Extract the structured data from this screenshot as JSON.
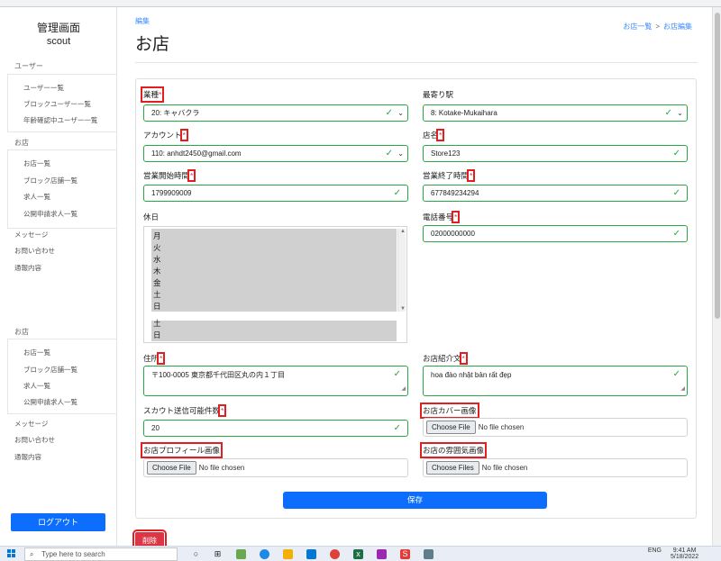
{
  "sidebar": {
    "title": "管理画面",
    "subtitle": "scout",
    "group_users": "ユーザー",
    "users_items": [
      "ユーザー一覧",
      "ブロックユーザー一覧",
      "年齢確認中ユーザー一覧"
    ],
    "group_shops": "お店",
    "shop_items": [
      "お店一覧",
      "ブロック店舗一覧",
      "求人一覧",
      "公開申請求人一覧"
    ],
    "links": [
      "メッセージ",
      "お問い合わせ",
      "通報内容"
    ],
    "group_shops_2": "お店",
    "shop_items_2": [
      "お店一覧",
      "ブロック店舗一覧",
      "求人一覧",
      "公開申請求人一覧"
    ],
    "links_2": [
      "メッセージ",
      "お問い合わせ",
      "通報内容"
    ],
    "logout": "ログアウト"
  },
  "header": {
    "section": "編集",
    "title": "お店",
    "breadcrumb": [
      "お店一覧",
      "お店編集"
    ],
    "breadcrumb_sep": ">"
  },
  "form": {
    "business_type": {
      "label": "業種",
      "value": "20: キャバクラ"
    },
    "nearest_station": {
      "label": "最寄り駅",
      "value": "8: Kotake-Mukaihara"
    },
    "account": {
      "label": "アカウント",
      "value": "110: anhdt2450@gmail.com"
    },
    "shop_name": {
      "label": "店名",
      "value": "Store123"
    },
    "open_time": {
      "label": "営業開始時間",
      "value": "1799909009"
    },
    "close_time": {
      "label": "営業終了時間",
      "value": "677849234294"
    },
    "holidays": {
      "label": "休日",
      "options": [
        "月",
        "火",
        "水",
        "木",
        "金",
        "土",
        "日"
      ],
      "options_tail": [
        "土",
        "日"
      ]
    },
    "phone": {
      "label": "電話番号",
      "value": "02000000000"
    },
    "address": {
      "label": "住所",
      "value": "〒100-0005 東京都千代田区丸の内１丁目"
    },
    "intro": {
      "label": "お店紹介文",
      "value": "hoa đào nhật bản rất đẹp"
    },
    "scout_count": {
      "label": "スカウト送信可能件数",
      "value": "20"
    },
    "cover_image": {
      "label": "お店カバー画像",
      "button": "Choose File",
      "status": "No file chosen"
    },
    "profile_image": {
      "label": "お店プロフィール画像",
      "button": "Choose File",
      "status": "No file chosen"
    },
    "atmosphere_images": {
      "label": "お店の雰囲気画像",
      "button": "Choose Files",
      "status": "No file chosen"
    },
    "required_mark": "*",
    "save": "保存",
    "delete": "削除"
  },
  "taskbar": {
    "search_placeholder": "Type here to search",
    "lang": "ENG",
    "time": "9:41 AM",
    "date": "5/18/2022"
  },
  "colors": {
    "primary": "#0d6efd",
    "valid": "#28a745",
    "danger": "#dc3545",
    "highlight": "#e02020"
  }
}
